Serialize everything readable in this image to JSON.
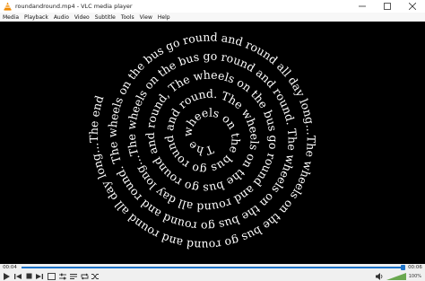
{
  "window": {
    "title": "roundandround.mp4 - VLC media player",
    "app_icon": "vlc-cone-icon"
  },
  "menu": [
    "Media",
    "Playback",
    "Audio",
    "Video",
    "Subtitle",
    "Tools",
    "View",
    "Help"
  ],
  "video": {
    "spiral_text": "The wheels on the bus go round and round. The wheels on the bus go round and round, The wheels on the bus go round and round all day long...The wheels on the bus go round and round. The wheels on the bus go round and round. The wheels on the bus go round and round all day long...The wheels on the bus go round and round all day long...The end",
    "text_color": "#ffffff",
    "background": "#000000"
  },
  "playback": {
    "elapsed": "00:04",
    "duration": "00:06",
    "progress_fraction": 1.0,
    "accent": "#1e73c8",
    "volume_percent": "100%",
    "volume_fraction": 1.0
  }
}
